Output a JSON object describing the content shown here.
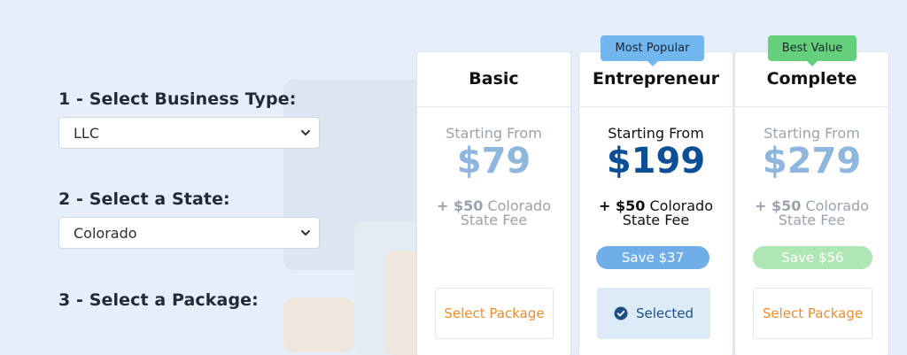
{
  "form": {
    "step1": {
      "label": "1 - Select Business Type:",
      "value": "LLC"
    },
    "step2": {
      "label": "2 - Select a State:",
      "value": "Colorado"
    },
    "step3": {
      "label": "3 - Select a Package:"
    }
  },
  "packages": [
    {
      "title": "Basic",
      "starting": "Starting From",
      "price": "$79",
      "fee_amount": "+ $50",
      "fee_text": "Colorado State Fee",
      "button": "Select Package",
      "selected": false
    },
    {
      "title": "Entrepreneur",
      "badge": "Most Popular",
      "starting": "Starting From",
      "price": "$199",
      "fee_amount": "+ $50",
      "fee_text": "Colorado State Fee",
      "save": "Save $37",
      "button": "Selected",
      "selected": true
    },
    {
      "title": "Complete",
      "badge": "Best Value",
      "starting": "Starting From",
      "price": "$279",
      "fee_amount": "+ $50",
      "fee_text": "Colorado State Fee",
      "save": "Save $56",
      "button": "Select Package",
      "selected": false
    }
  ],
  "colors": {
    "background": "#e6eff9",
    "accent_orange": "#f08c2a",
    "accent_blue": "#0d4f97",
    "badge_blue": "#72b6f0",
    "badge_green": "#65d07c"
  }
}
